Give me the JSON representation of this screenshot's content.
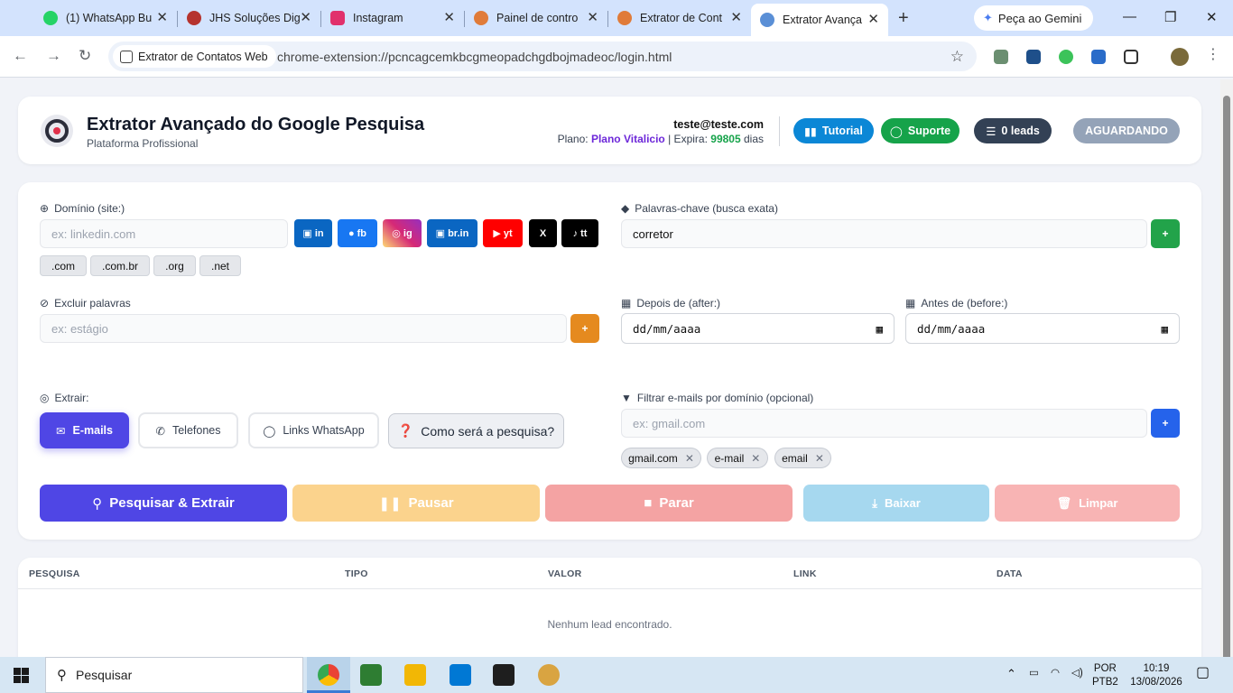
{
  "browser": {
    "tabs": [
      {
        "title": "(1) WhatsApp Bu",
        "color": "#25d366",
        "icon": "whatsapp-icon"
      },
      {
        "title": "JHS Soluções Dig",
        "color": "#b5332e",
        "icon": "jhs-icon"
      },
      {
        "title": "Instagram",
        "color": "#e1306c",
        "icon": "instagram-icon"
      },
      {
        "title": "Painel de contro",
        "color": "#e07b39",
        "icon": "panel-icon"
      },
      {
        "title": "Extrator de Cont",
        "color": "#e07b39",
        "icon": "extractor-icon"
      },
      {
        "title": "Extrator Avança",
        "color": "#5a8fd6",
        "icon": "person-icon"
      }
    ],
    "gemini_label": "Peça ao Gemini",
    "site_chip": "Extrator de Contatos Web",
    "url": "chrome-extension://pcncagcemkbcgmeopadchgdbojmadeoc/login.html"
  },
  "header": {
    "title": "Extrator Avançado do Google Pesquisa",
    "subtitle": "Plataforma Profissional",
    "email": "teste@teste.com",
    "plan_label": "Plano:",
    "plan": "Plano Vitalicio",
    "expires_label": "| Expira:",
    "expires_days": "99805",
    "days_label": "dias",
    "tutorial": "Tutorial",
    "support": "Suporte",
    "leads": "0 leads",
    "status": "AGUARDANDO"
  },
  "form": {
    "domain_label": "Domínio (site:)",
    "domain_placeholder": "ex: linkedin.com",
    "social": [
      {
        "label": "in",
        "color": "#0a66c2",
        "icon": "linkedin-icon"
      },
      {
        "label": "fb",
        "color": "#1877f2",
        "icon": "facebook-icon"
      },
      {
        "label": "ig",
        "color": "#d62976",
        "icon": "instagram-icon"
      },
      {
        "label": "br.in",
        "color": "#0a66c2",
        "icon": "linkedin-icon"
      },
      {
        "label": "yt",
        "color": "#ff0000",
        "icon": "youtube-icon"
      },
      {
        "label": "X",
        "color": "#000000",
        "icon": "x-icon"
      },
      {
        "label": "tt",
        "color": "#000000",
        "icon": "tiktok-icon"
      }
    ],
    "tlds": [
      ".com",
      ".com.br",
      ".org",
      ".net"
    ],
    "keywords_label": "Palavras-chave (busca exata)",
    "keywords_value": "corretor",
    "exclude_label": "Excluir palavras",
    "exclude_placeholder": "ex: estágio",
    "after_label": "Depois de (after:)",
    "before_label": "Antes de (before:)",
    "date_placeholder": "dd/mm/aaaa",
    "extract_label": "Extrair:",
    "extract_emails": "E-mails",
    "extract_phones": "Telefones",
    "extract_whatsapp": "Links WhatsApp",
    "how_search": "Como será a pesquisa?",
    "filter_label": "Filtrar e-mails por domínio (opcional)",
    "filter_placeholder": "ex: gmail.com",
    "filter_tags": [
      "gmail.com",
      "e-mail",
      "email"
    ],
    "plus": "+"
  },
  "actions": {
    "search": "Pesquisar & Extrair",
    "pause": "Pausar",
    "stop": "Parar",
    "download": "Baixar",
    "clear": "Limpar"
  },
  "table": {
    "columns": [
      "PESQUISA",
      "TIPO",
      "VALOR",
      "LINK",
      "DATA"
    ],
    "empty": "Nenhum lead encontrado."
  },
  "taskbar": {
    "search": "Pesquisar",
    "lang": "POR",
    "layout": "PTB2",
    "time": "10:19",
    "date": "13/08/2026"
  },
  "colors": {
    "primary": "#4f46e5",
    "success": "#22a34a",
    "warning": "#e58a1f",
    "tutorial": "#0b87d6",
    "support": "#16a34a",
    "leads": "#334155",
    "status": "#94a3b8"
  }
}
